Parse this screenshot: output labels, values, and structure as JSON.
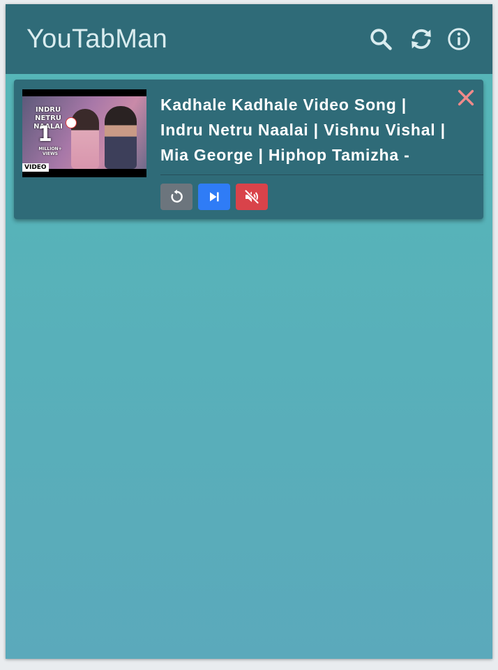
{
  "header": {
    "title": "YouTabMan",
    "icons": [
      "search-icon",
      "refresh-icon",
      "info-icon"
    ]
  },
  "tabs": [
    {
      "title": "Kadhale Kadhale Video Song | Indru Netru Naalai | Vishnu Vishal | Mia George | Hiphop Tamizha -",
      "thumbnail": {
        "overlay_title": "INDRU NETRU NAALAI",
        "overlay_count": "1",
        "overlay_views": "MILLION+ VIEWS",
        "badge": "VIDEO"
      },
      "controls": [
        "replay-icon",
        "skip-next-icon",
        "volume-off-icon"
      ],
      "close_icon": "close-icon"
    }
  ],
  "colors": {
    "header_bg": "#2f6b78",
    "card_bg": "#2f6b78",
    "body_top": "#55b8b8",
    "body_bottom": "#5ba9bb",
    "reload_btn": "#6c757d",
    "next_btn": "#2f7cf6",
    "mute_btn": "#d9434a",
    "close_icon": "#f08a8a"
  }
}
